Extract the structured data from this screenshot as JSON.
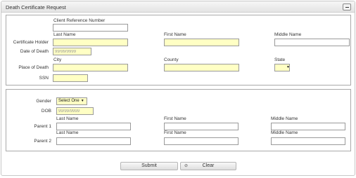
{
  "panel": {
    "title": "Death Certificate Request"
  },
  "deceased": {
    "client_ref_label": "Client Reference Number",
    "holder_row_label": "Certificate Holder",
    "last_name_label": "Last Name",
    "first_name_label": "First Name",
    "middle_name_label": "Middle Name",
    "date_of_death_label": "Date of Death",
    "date_placeholder": "99/99/9999",
    "place_row_label": "Place of Death",
    "city_label": "City",
    "county_label": "County",
    "state_label": "State",
    "ssn_label": "SSN"
  },
  "parents": {
    "gender_label": "Gender",
    "gender_value": "Select One",
    "dob_label": "DOB",
    "dob_placeholder": "99/99/9999",
    "last_name_label": "Last Name",
    "first_name_label": "First Name",
    "middle_name_label": "Middle Name",
    "parent1_label": "Parent 1",
    "parent2_label": "Parent 2"
  },
  "actions": {
    "submit_label": "Submit",
    "clear_label": "Clear"
  },
  "icons": {
    "collapse": "collapse-icon",
    "clear": "clear-icon"
  },
  "colors": {
    "required_field": "#ffffc4",
    "border": "#a9a9a9"
  }
}
